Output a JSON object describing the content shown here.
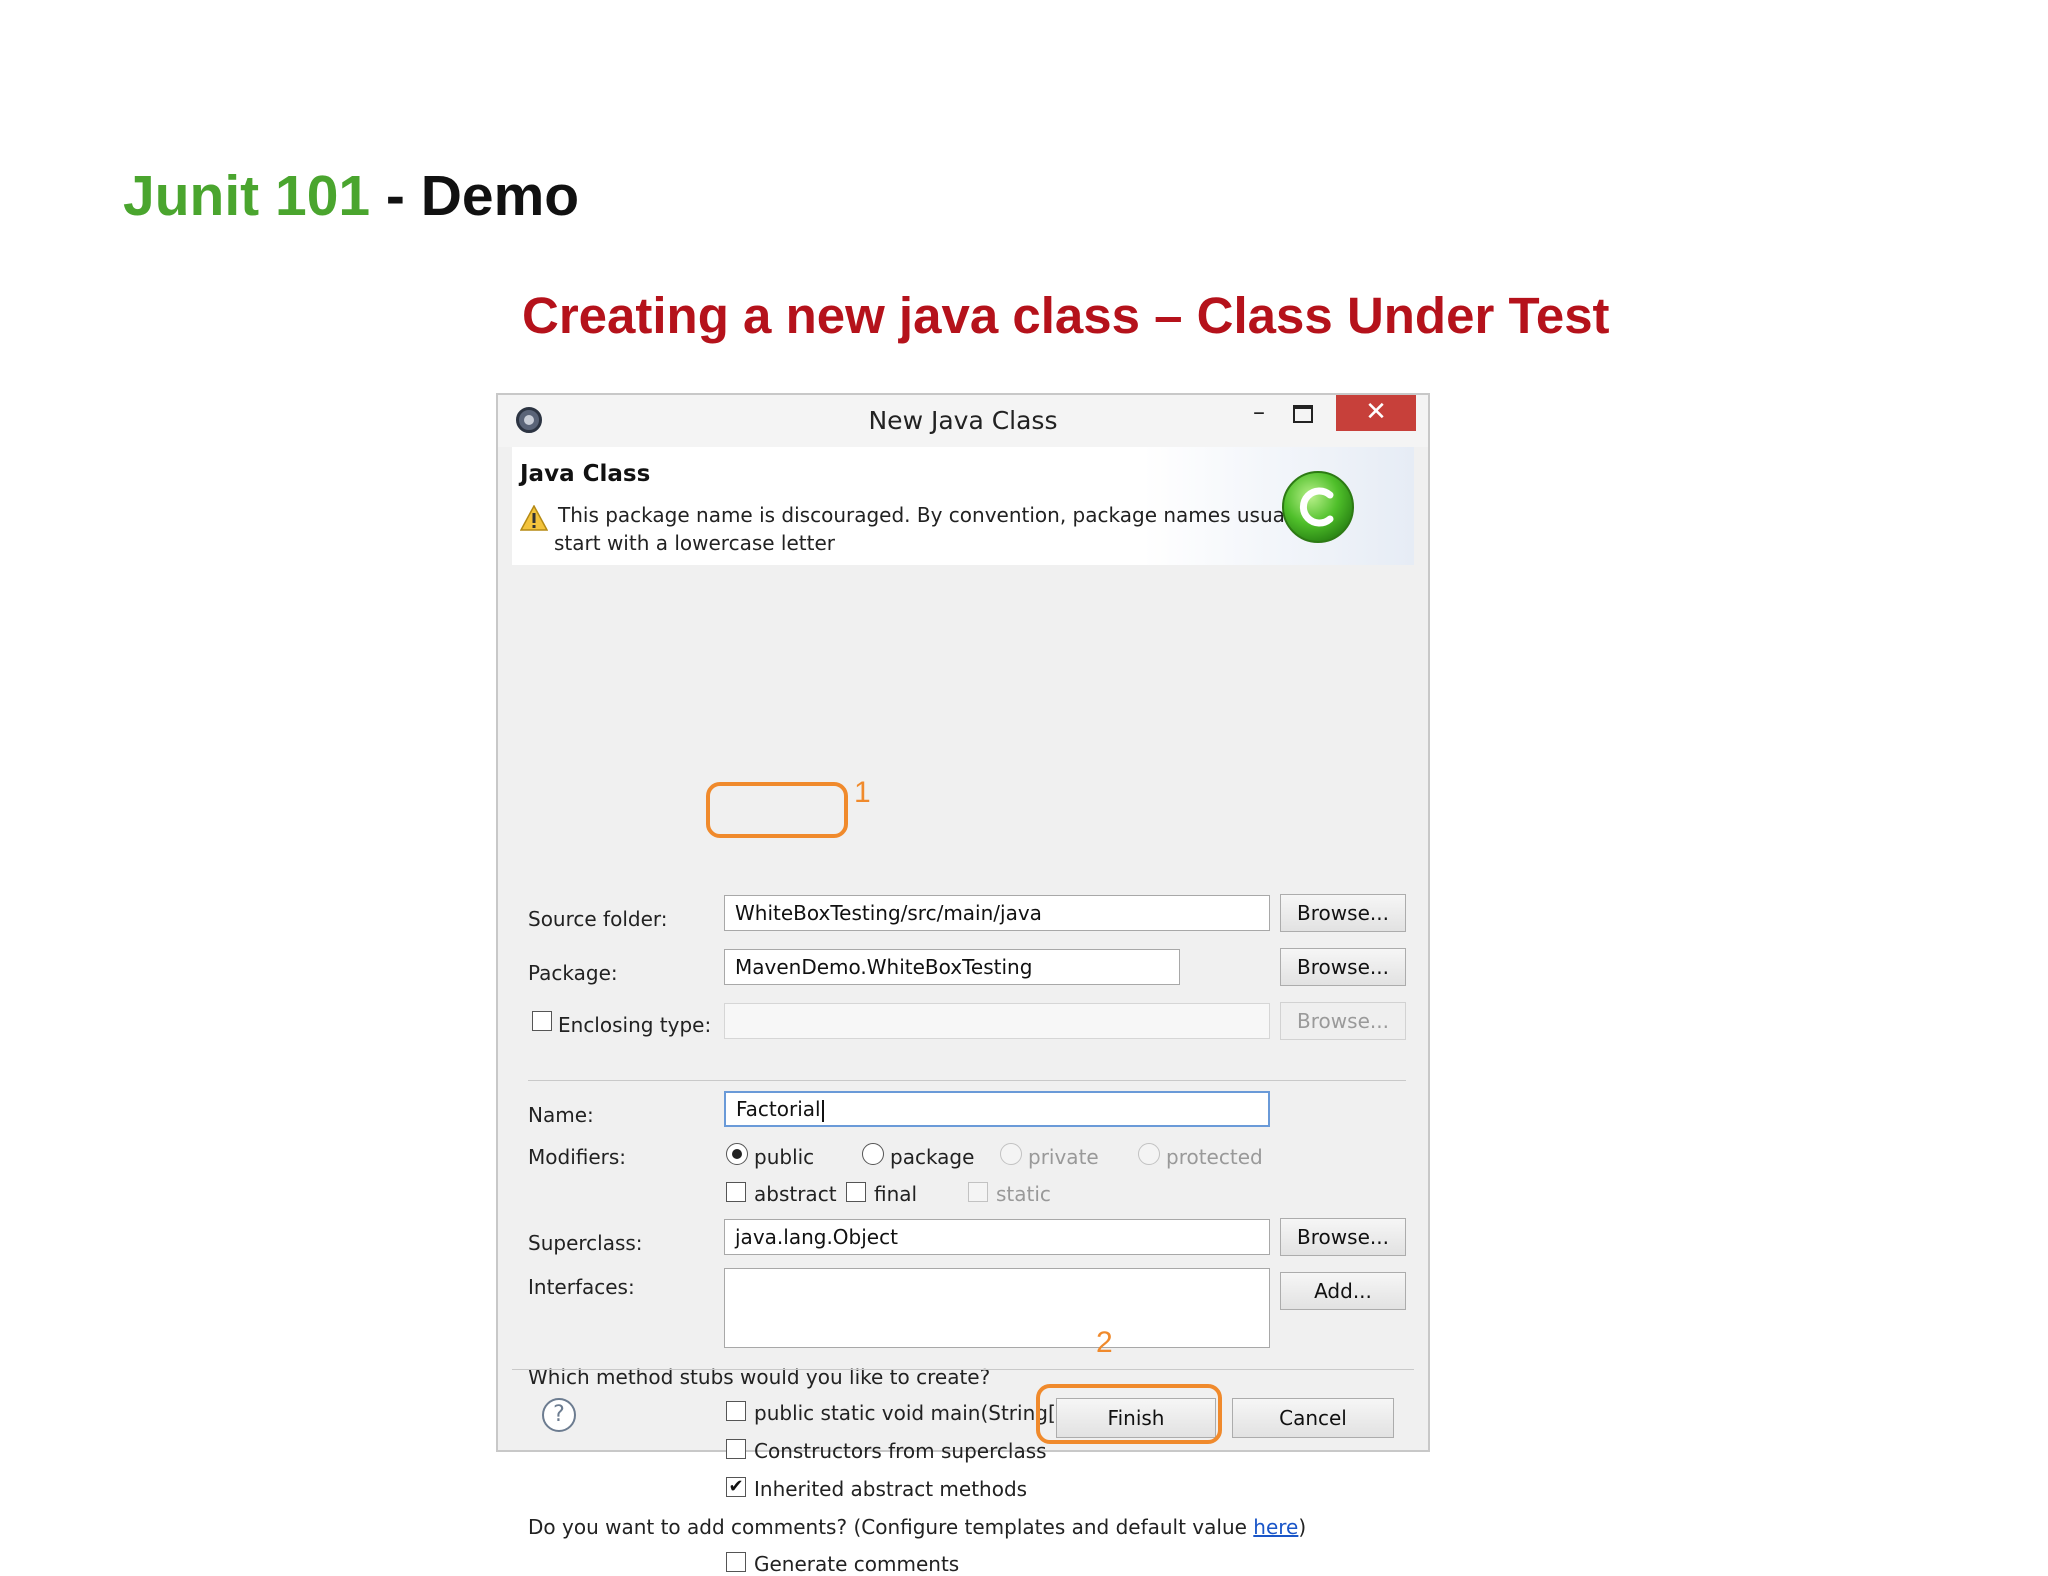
{
  "slide": {
    "title_main": "Junit 101",
    "title_rest": " - Demo",
    "subtitle": "Creating a new java class – Class Under Test"
  },
  "dialog": {
    "window_title": "New Java Class",
    "minimize": "–",
    "close": "✕",
    "header_title": "Java Class",
    "warning_line1": "This package name is discouraged. By convention, package names usually",
    "warning_line2": "start with a lowercase letter",
    "source_folder_label": "Source folder:",
    "source_folder_value": "WhiteBoxTesting/src/main/java",
    "package_label": "Package:",
    "package_value": "MavenDemo.WhiteBoxTesting",
    "enclosing_label": "Enclosing type:",
    "browse_label": "Browse...",
    "name_label": "Name:",
    "name_value": "Factorial",
    "modifiers_label": "Modifiers:",
    "modifiers": {
      "public": "public",
      "package": "package",
      "private": "private",
      "protected": "protected",
      "abstract": "abstract",
      "final": "final",
      "static": "static",
      "selected": "public"
    },
    "superclass_label": "Superclass:",
    "superclass_value": "java.lang.Object",
    "interfaces_label": "Interfaces:",
    "add_label": "Add...",
    "stubs_question": "Which method stubs would you like to create?",
    "stubs": {
      "main": "public static void main(String[] args)",
      "constructors": "Constructors from superclass",
      "inherited": "Inherited abstract methods"
    },
    "stubs_checked": {
      "main": false,
      "constructors": false,
      "inherited": true
    },
    "comments_question": "Do you want to add comments? (Configure templates and default value ",
    "comments_link": "here",
    "comments_close": ")",
    "generate_comments": "Generate comments",
    "help": "?",
    "finish": "Finish",
    "cancel": "Cancel"
  },
  "annotations": {
    "step1": "1",
    "step2": "2",
    "color": "#f08a2c"
  },
  "colors": {
    "title_green": "#4aa52e",
    "subtitle_red": "#b5121b",
    "close_red": "#c7403a"
  },
  "icons": {
    "app": "eclipse-icon",
    "warning": "warning-icon",
    "class": "java-class-icon",
    "help": "help-icon"
  }
}
